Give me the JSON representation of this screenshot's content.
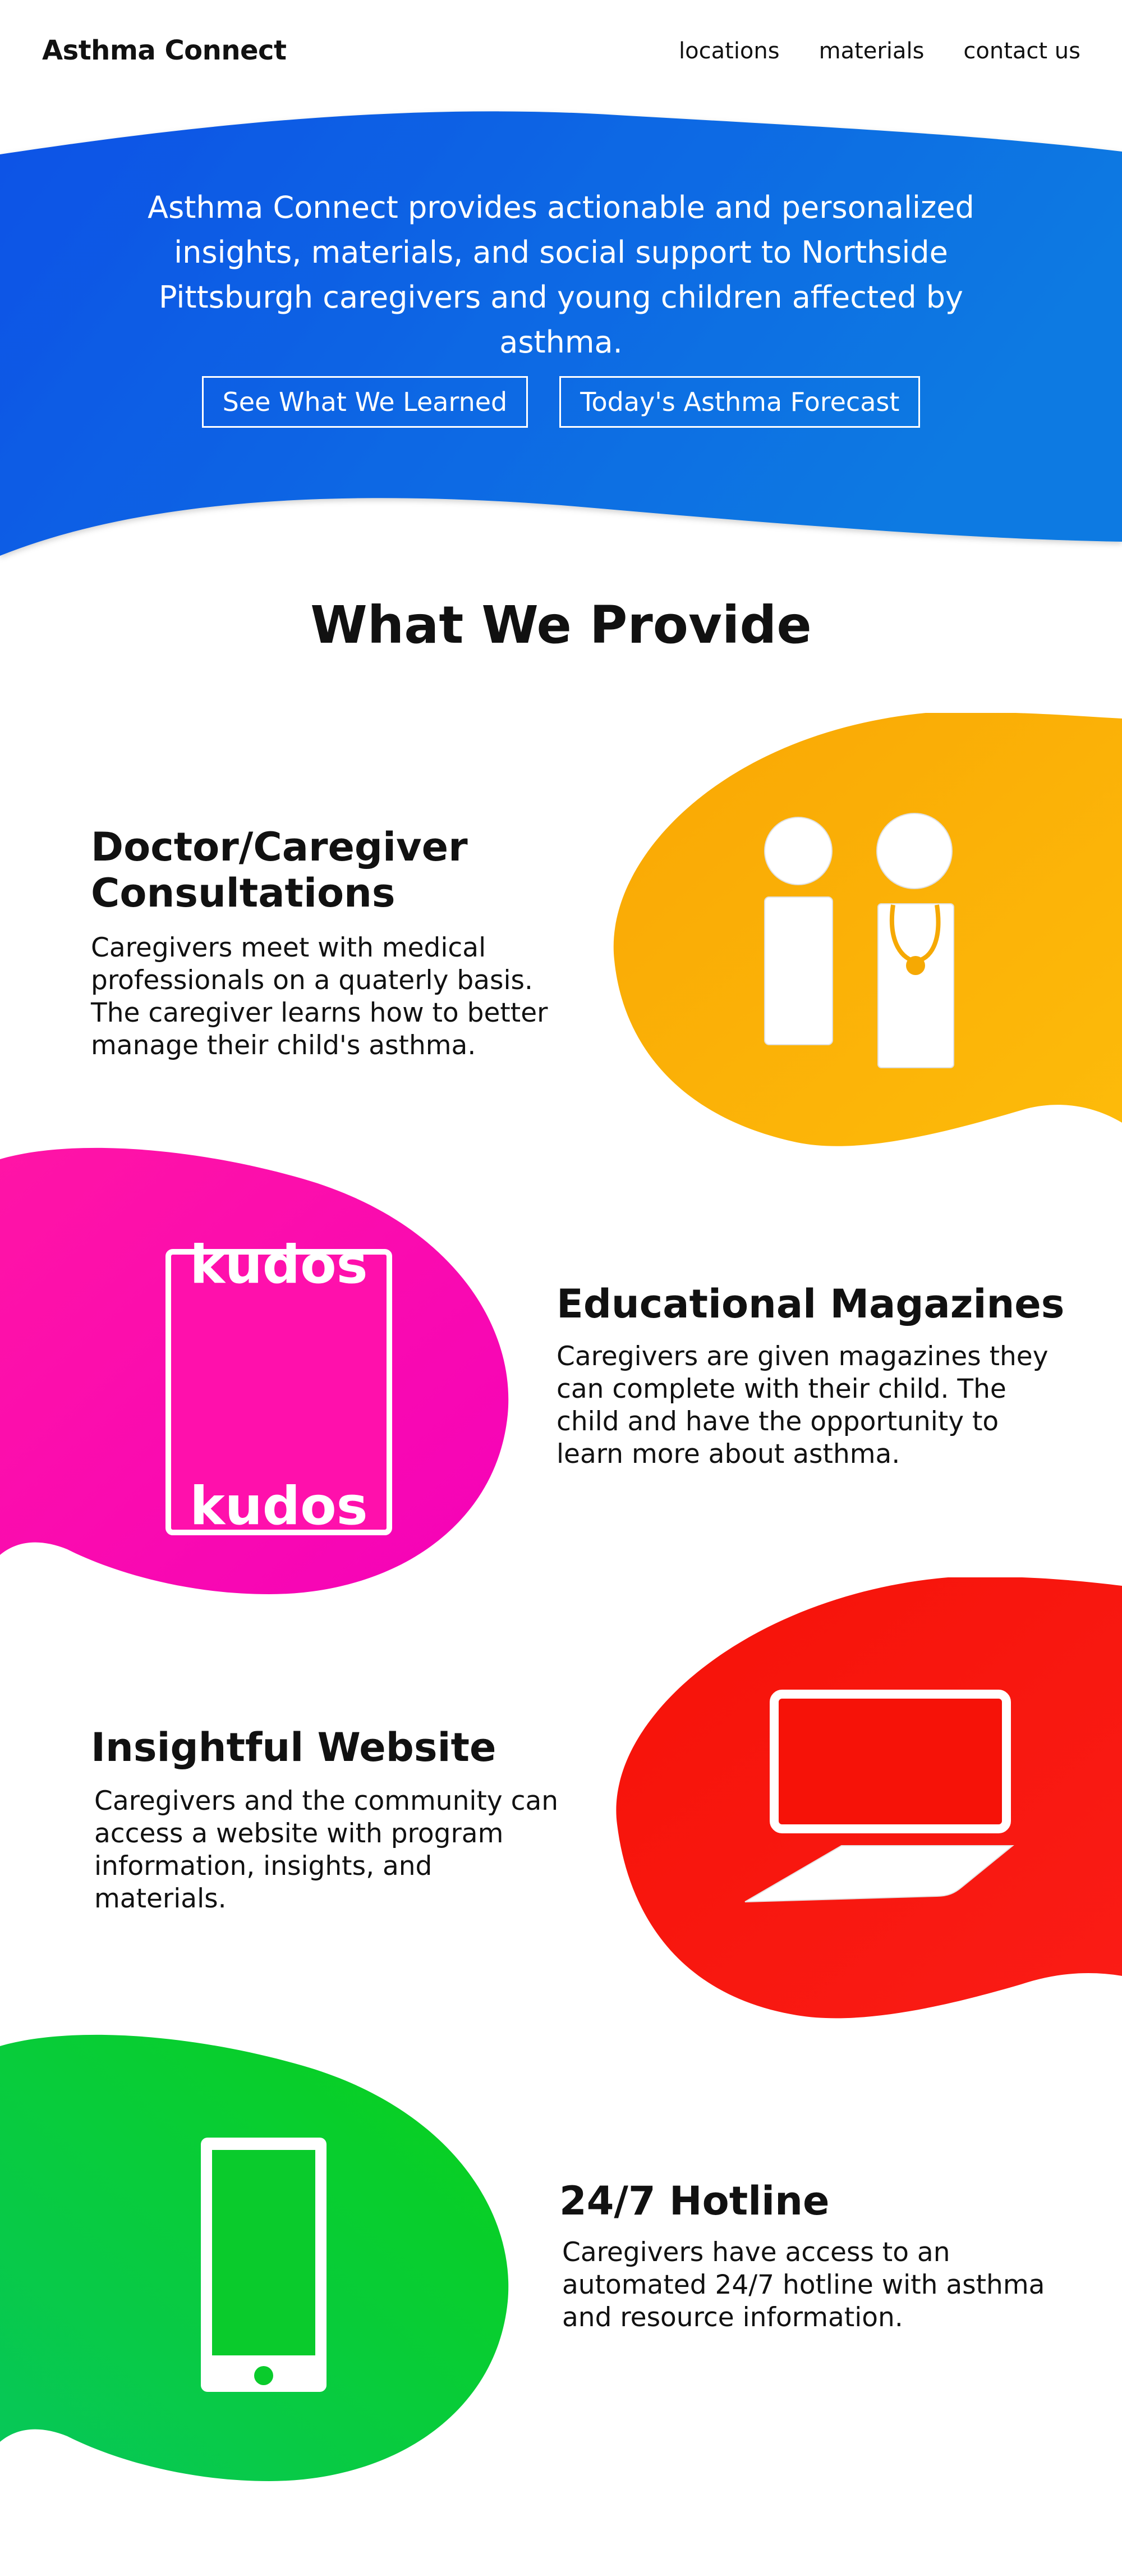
{
  "header": {
    "brand": "Asthma Connect",
    "nav": [
      "locations",
      "materials",
      "contact us"
    ]
  },
  "hero": {
    "text": "Asthma Connect provides actionable and personalized insights, materials, and social support to Northside Pittsburgh caregivers and young children affected by asthma.",
    "buttons": [
      "See What We Learned",
      "Today's Asthma Forecast"
    ],
    "gradient": [
      "#0a52e6",
      "#0a78e0"
    ]
  },
  "provide": {
    "title": "What We Provide",
    "features": [
      {
        "heading": "Doctor/Caregiver Consultations",
        "body": "Caregivers meet with medical professionals on a quaterly basis. The caregiver learns how to better manage their child's asthma.",
        "icon": "doctor-caregiver-icon",
        "color": "#fbb105"
      },
      {
        "heading": "Educational Magazines",
        "body": "Caregivers are given magazines they can complete with their child. The child and have the opportunity to learn more about asthma.",
        "icon": "magazine-icon",
        "icon_text": "kudos",
        "color": "#ff0aa8"
      },
      {
        "heading": "Insightful Website",
        "body": "Caregivers and the community can access a website with program information, insights, and materials.",
        "icon": "laptop-icon",
        "color": "#f81210"
      },
      {
        "heading": "24/7 Hotline",
        "body": "Caregivers have access to an automated 24/7 hotline with asthma and resource information.",
        "icon": "phone-icon",
        "color": "#0acb2c"
      }
    ]
  }
}
